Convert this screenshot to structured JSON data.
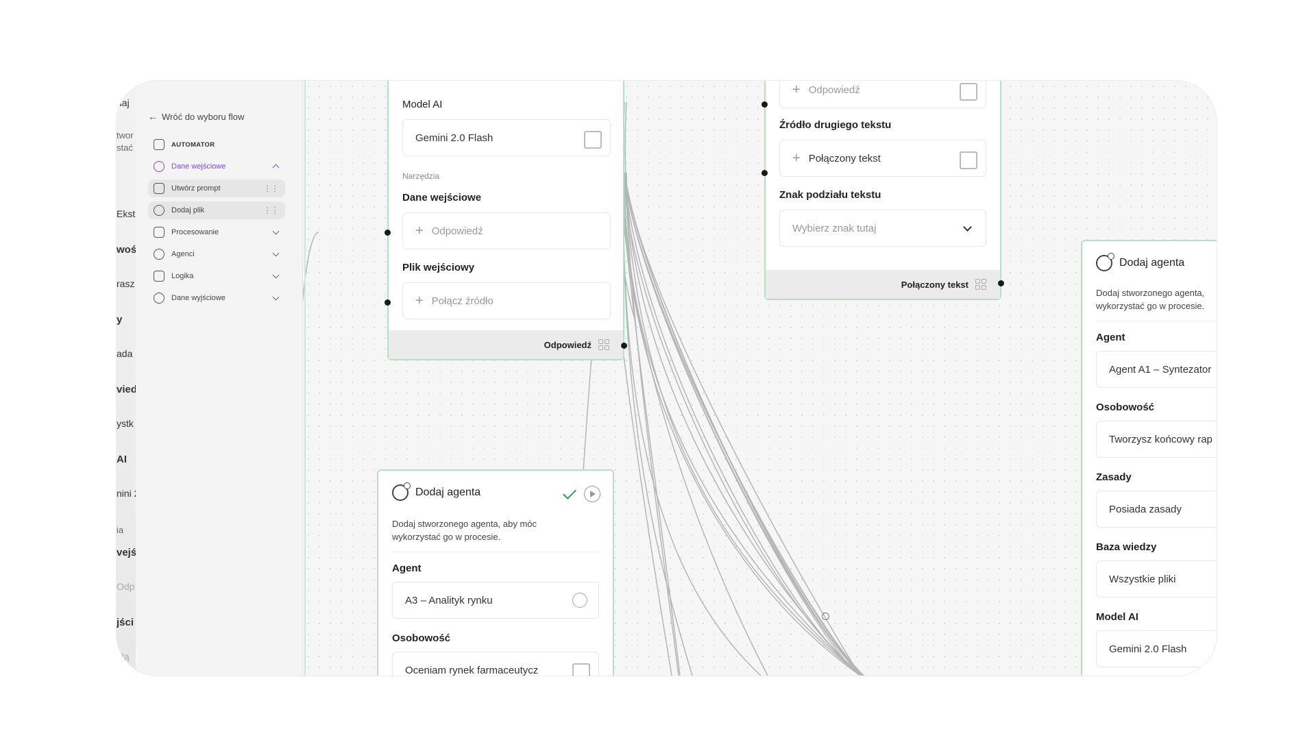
{
  "ghost_panel": [
    "daj",
    "twor",
    "stać",
    "Ekst",
    "woś",
    "rasz",
    "y",
    "ada",
    "vied",
    "ystk",
    "AI",
    "nini 2",
    "ia",
    "vejś",
    "Odp",
    "jści",
    "ołą"
  ],
  "sidebar": {
    "back_label": "Wróć do wyboru flow",
    "section_label": "AUTOMATOR",
    "items": [
      {
        "label": "Dane wejściowe"
      },
      {
        "label": "Utwórz prompt"
      },
      {
        "label": "Dodaj plik"
      },
      {
        "label": "Procesowanie"
      },
      {
        "label": "Agenci"
      },
      {
        "label": "Logika"
      },
      {
        "label": "Dane wyjściowe"
      }
    ]
  },
  "node_prompt": {
    "model_label": "Model AI",
    "model_value": "Gemini 2.0 Flash",
    "tools_label": "Narzędzia",
    "input_label": "Dane wejściowe",
    "input_placeholder": "Odpowiedź",
    "file_label": "Plik wejściowy",
    "file_placeholder": "Połącz źródło",
    "footer_label": "Odpowiedź"
  },
  "node_agent_a3": {
    "title": "Dodaj agenta",
    "desc1": "Dodaj stworzonego agenta, aby móc",
    "desc2": "wykorzystać go w procesie.",
    "agent_label": "Agent",
    "agent_value": "A3 – Analityk rynku",
    "personality_label": "Osobowość",
    "personality_value": "Oceniam rynek farmaceutycz"
  },
  "node_merge": {
    "first_placeholder": "Odpowiedź",
    "second_label": "Źródło drugiego tekstu",
    "second_value": "Połączony tekst",
    "separator_label": "Znak podziału tekstu",
    "separator_placeholder": "Wybierz znak tutaj",
    "footer_label": "Połączony tekst"
  },
  "node_agent_a1": {
    "title": "Dodaj agenta",
    "desc1": "Dodaj stworzonego agenta,",
    "desc2": "wykorzystać go w procesie.",
    "agent_label": "Agent",
    "agent_value": "Agent A1 – Syntezator",
    "personality_label": "Osobowość",
    "personality_value": "Tworzysz końcowy rap",
    "rules_label": "Zasady",
    "rules_value": "Posiada zasady",
    "kb_label": "Baza wiedzy",
    "kb_value": "Wszystkie pliki",
    "model_label": "Model AI",
    "model_value": "Gemini 2.0 Flash"
  }
}
